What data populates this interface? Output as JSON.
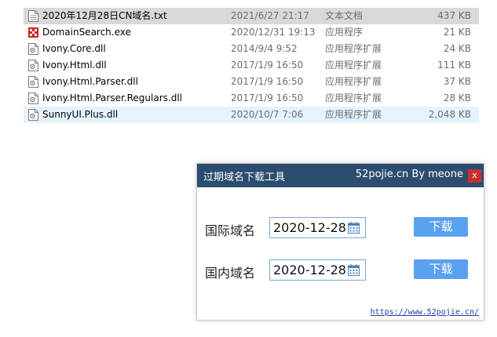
{
  "files": [
    {
      "name": "2020年12月28日CN域名.txt",
      "date": "2021/6/27 21:17",
      "type": "文本文档",
      "size": "437 KB",
      "icon": "text-file-icon",
      "state": "selected"
    },
    {
      "name": "DomainSearch.exe",
      "date": "2020/12/31 19:13",
      "type": "应用程序",
      "size": "21 KB",
      "icon": "app-icon",
      "state": ""
    },
    {
      "name": "Ivony.Core.dll",
      "date": "2014/9/4 9:52",
      "type": "应用程序扩展",
      "size": "24 KB",
      "icon": "dll-file-icon",
      "state": ""
    },
    {
      "name": "Ivony.Html.dll",
      "date": "2017/1/9 16:50",
      "type": "应用程序扩展",
      "size": "111 KB",
      "icon": "dll-file-icon",
      "state": ""
    },
    {
      "name": "Ivony.Html.Parser.dll",
      "date": "2017/1/9 16:50",
      "type": "应用程序扩展",
      "size": "37 KB",
      "icon": "dll-file-icon",
      "state": ""
    },
    {
      "name": "Ivony.Html.Parser.Regulars.dll",
      "date": "2017/1/9 16:50",
      "type": "应用程序扩展",
      "size": "28 KB",
      "icon": "dll-file-icon",
      "state": ""
    },
    {
      "name": "SunnyUI.Plus.dll",
      "date": "2020/10/7 7:06",
      "type": "应用程序扩展",
      "size": "2,048 KB",
      "icon": "dll-file-icon",
      "state": "hover"
    }
  ],
  "dialog": {
    "title": "过期域名下载工具",
    "credit": "52pojie.cn By meone",
    "close_label": "x",
    "rows": [
      {
        "label": "国际域名",
        "date": "2020-12-28",
        "button": "下载"
      },
      {
        "label": "国内域名",
        "date": "2020-12-28",
        "button": "下载"
      }
    ],
    "footer_link": "https://www.52pojie.cn/"
  },
  "colors": {
    "titlebar": "#2c4d6f",
    "download_button": "#5aa1f0",
    "close_button": "#c8302e",
    "selected_row": "#d9d9d9",
    "hover_row": "#e5f3ff"
  }
}
